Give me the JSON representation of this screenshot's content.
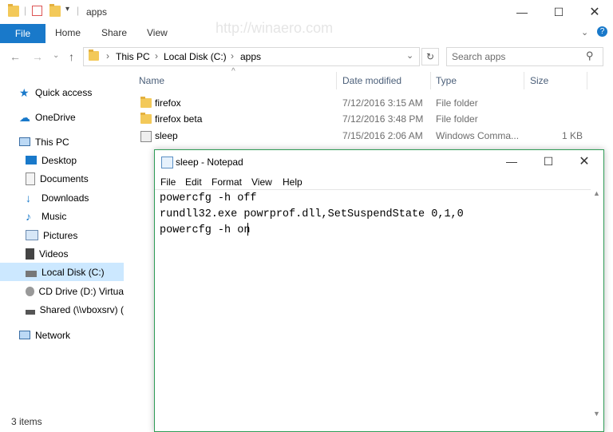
{
  "explorer": {
    "title": "apps",
    "ribbon_tabs": [
      "File",
      "Home",
      "Share",
      "View"
    ],
    "breadcrumb": [
      "This PC",
      "Local Disk (C:)",
      "apps"
    ],
    "search_placeholder": "Search apps",
    "columns": [
      "Name",
      "Date modified",
      "Type",
      "Size"
    ],
    "files": [
      {
        "name": "firefox",
        "date": "7/12/2016 3:15 AM",
        "type": "File folder",
        "size": "",
        "icon": "folder-icon"
      },
      {
        "name": "firefox beta",
        "date": "7/12/2016 3:48 PM",
        "type": "File folder",
        "size": "",
        "icon": "folder-icon"
      },
      {
        "name": "sleep",
        "date": "7/15/2016 2:06 AM",
        "type": "Windows Comma...",
        "size": "1 KB",
        "icon": "batch-file-icon"
      }
    ],
    "nav": [
      {
        "label": "Quick access",
        "icon": "star-icon"
      },
      {
        "label": "OneDrive",
        "icon": "cloud-icon"
      },
      {
        "label": "This PC",
        "icon": "computer-icon"
      },
      {
        "label": "Desktop",
        "icon": "desktop-icon"
      },
      {
        "label": "Documents",
        "icon": "documents-icon"
      },
      {
        "label": "Downloads",
        "icon": "download-icon"
      },
      {
        "label": "Music",
        "icon": "music-icon"
      },
      {
        "label": "Pictures",
        "icon": "pictures-icon"
      },
      {
        "label": "Videos",
        "icon": "videos-icon"
      },
      {
        "label": "Local Disk (C:)",
        "icon": "drive-icon"
      },
      {
        "label": "CD Drive (D:) Virtua",
        "icon": "cd-drive-icon"
      },
      {
        "label": "Shared (\\\\vboxsrv) (",
        "icon": "network-drive-icon"
      },
      {
        "label": "Network",
        "icon": "network-icon"
      }
    ],
    "status": "3 items",
    "watermark": "http://winaero.com"
  },
  "notepad": {
    "title": "sleep - Notepad",
    "menu": [
      "File",
      "Edit",
      "Format",
      "View",
      "Help"
    ],
    "lines": [
      "powercfg -h off",
      "rundll32.exe powrprof.dll,SetSuspendState 0,1,0",
      "powercfg -h on"
    ]
  },
  "colors": {
    "accent": "#1979ca",
    "selection": "#cce8ff",
    "notepad_border": "#2f9c57"
  }
}
